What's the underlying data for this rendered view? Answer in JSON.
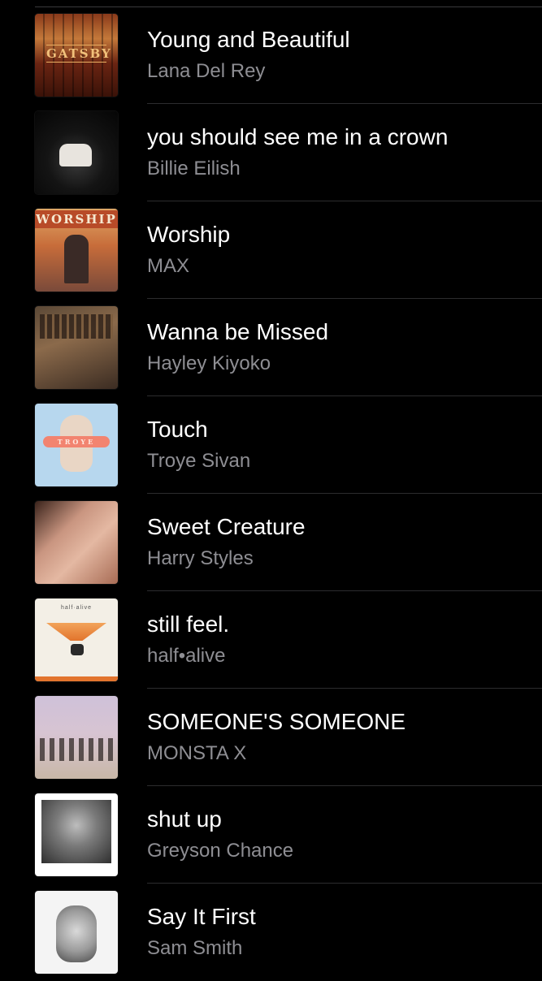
{
  "songs": [
    {
      "title": "Young and Beautiful",
      "artist": "Lana Del Rey",
      "art_text": "GATSBY"
    },
    {
      "title": "you should see me in a crown",
      "artist": "Billie Eilish"
    },
    {
      "title": "Worship",
      "artist": "MAX",
      "art_text": "WORSHIP"
    },
    {
      "title": "Wanna be Missed",
      "artist": "Hayley Kiyoko"
    },
    {
      "title": "Touch",
      "artist": "Troye Sivan",
      "art_text": "TROYE"
    },
    {
      "title": "Sweet Creature",
      "artist": "Harry Styles"
    },
    {
      "title": "still feel.",
      "artist": "half•alive",
      "art_text": "half·alive"
    },
    {
      "title": "SOMEONE'S SOMEONE",
      "artist": "MONSTA X"
    },
    {
      "title": "shut up",
      "artist": "Greyson Chance"
    },
    {
      "title": "Say It First",
      "artist": "Sam Smith"
    }
  ],
  "colors": {
    "background": "#000000",
    "title": "#ffffff",
    "subtitle": "#8e8e93",
    "divider": "#2c2c2e"
  }
}
